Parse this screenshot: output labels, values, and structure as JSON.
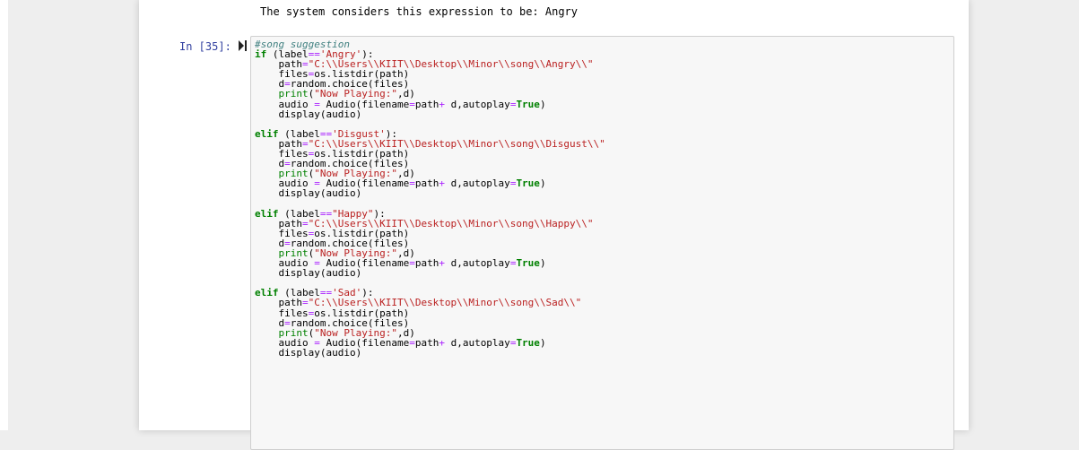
{
  "output": {
    "text": "The system considers this expression to be: Angry"
  },
  "cell": {
    "prompt": "In [35]:",
    "run_icon": "run-step-icon",
    "lines": [
      [
        {
          "t": "#song suggestion",
          "c": "cm"
        }
      ],
      [
        {
          "t": "if",
          "c": "kw"
        },
        {
          "t": " (label"
        },
        {
          "t": "==",
          "c": "op"
        },
        {
          "t": "'Angry'",
          "c": "st"
        },
        {
          "t": "):"
        }
      ],
      [
        {
          "t": "    path"
        },
        {
          "t": "=",
          "c": "op"
        },
        {
          "t": "\"C:\\\\Users\\\\KIIT\\\\Desktop\\\\Minor\\\\song\\\\Angry\\\\\"",
          "c": "st"
        }
      ],
      [
        {
          "t": "    files"
        },
        {
          "t": "=",
          "c": "op"
        },
        {
          "t": "os.listdir(path)"
        }
      ],
      [
        {
          "t": "    d"
        },
        {
          "t": "=",
          "c": "op"
        },
        {
          "t": "random.choice(files)"
        }
      ],
      [
        {
          "t": "    "
        },
        {
          "t": "print",
          "c": "bi"
        },
        {
          "t": "("
        },
        {
          "t": "\"Now Playing:\"",
          "c": "st"
        },
        {
          "t": ",d)"
        }
      ],
      [
        {
          "t": "    audio "
        },
        {
          "t": "=",
          "c": "op"
        },
        {
          "t": " Audio(filename"
        },
        {
          "t": "=",
          "c": "op"
        },
        {
          "t": "path"
        },
        {
          "t": "+",
          "c": "op"
        },
        {
          "t": " d,autoplay"
        },
        {
          "t": "=",
          "c": "op"
        },
        {
          "t": "True",
          "c": "kw"
        },
        {
          "t": ")"
        }
      ],
      [
        {
          "t": "    display(audio)"
        }
      ],
      [
        {
          "t": ""
        }
      ],
      [
        {
          "t": "elif",
          "c": "kw"
        },
        {
          "t": " (label"
        },
        {
          "t": "==",
          "c": "op"
        },
        {
          "t": "'Disgust'",
          "c": "st"
        },
        {
          "t": "):"
        }
      ],
      [
        {
          "t": "    path"
        },
        {
          "t": "=",
          "c": "op"
        },
        {
          "t": "\"C:\\\\Users\\\\KIIT\\\\Desktop\\\\Minor\\\\song\\\\Disgust\\\\\"",
          "c": "st"
        }
      ],
      [
        {
          "t": "    files"
        },
        {
          "t": "=",
          "c": "op"
        },
        {
          "t": "os.listdir(path)"
        }
      ],
      [
        {
          "t": "    d"
        },
        {
          "t": "=",
          "c": "op"
        },
        {
          "t": "random.choice(files)"
        }
      ],
      [
        {
          "t": "    "
        },
        {
          "t": "print",
          "c": "bi"
        },
        {
          "t": "("
        },
        {
          "t": "\"Now Playing:\"",
          "c": "st"
        },
        {
          "t": ",d)"
        }
      ],
      [
        {
          "t": "    audio "
        },
        {
          "t": "=",
          "c": "op"
        },
        {
          "t": " Audio(filename"
        },
        {
          "t": "=",
          "c": "op"
        },
        {
          "t": "path"
        },
        {
          "t": "+",
          "c": "op"
        },
        {
          "t": " d,autoplay"
        },
        {
          "t": "=",
          "c": "op"
        },
        {
          "t": "True",
          "c": "kw"
        },
        {
          "t": ")"
        }
      ],
      [
        {
          "t": "    display(audio)"
        }
      ],
      [
        {
          "t": ""
        }
      ],
      [
        {
          "t": "elif",
          "c": "kw"
        },
        {
          "t": " (label"
        },
        {
          "t": "==",
          "c": "op"
        },
        {
          "t": "\"Happy\"",
          "c": "st"
        },
        {
          "t": "):"
        }
      ],
      [
        {
          "t": "    path"
        },
        {
          "t": "=",
          "c": "op"
        },
        {
          "t": "\"C:\\\\Users\\\\KIIT\\\\Desktop\\\\Minor\\\\song\\\\Happy\\\\\"",
          "c": "st"
        }
      ],
      [
        {
          "t": "    files"
        },
        {
          "t": "=",
          "c": "op"
        },
        {
          "t": "os.listdir(path)"
        }
      ],
      [
        {
          "t": "    d"
        },
        {
          "t": "=",
          "c": "op"
        },
        {
          "t": "random.choice(files)"
        }
      ],
      [
        {
          "t": "    "
        },
        {
          "t": "print",
          "c": "bi"
        },
        {
          "t": "("
        },
        {
          "t": "\"Now Playing:\"",
          "c": "st"
        },
        {
          "t": ",d)"
        }
      ],
      [
        {
          "t": "    audio "
        },
        {
          "t": "=",
          "c": "op"
        },
        {
          "t": " Audio(filename"
        },
        {
          "t": "=",
          "c": "op"
        },
        {
          "t": "path"
        },
        {
          "t": "+",
          "c": "op"
        },
        {
          "t": " d,autoplay"
        },
        {
          "t": "=",
          "c": "op"
        },
        {
          "t": "True",
          "c": "kw"
        },
        {
          "t": ")"
        }
      ],
      [
        {
          "t": "    display(audio)"
        }
      ],
      [
        {
          "t": ""
        }
      ],
      [
        {
          "t": "elif",
          "c": "kw"
        },
        {
          "t": " (label"
        },
        {
          "t": "==",
          "c": "op"
        },
        {
          "t": "'Sad'",
          "c": "st"
        },
        {
          "t": "):"
        }
      ],
      [
        {
          "t": "    path"
        },
        {
          "t": "=",
          "c": "op"
        },
        {
          "t": "\"C:\\\\Users\\\\KIIT\\\\Desktop\\\\Minor\\\\song\\\\Sad\\\\\"",
          "c": "st"
        }
      ],
      [
        {
          "t": "    files"
        },
        {
          "t": "=",
          "c": "op"
        },
        {
          "t": "os.listdir(path)"
        }
      ],
      [
        {
          "t": "    d"
        },
        {
          "t": "=",
          "c": "op"
        },
        {
          "t": "random.choice(files)"
        }
      ],
      [
        {
          "t": "    "
        },
        {
          "t": "print",
          "c": "bi"
        },
        {
          "t": "("
        },
        {
          "t": "\"Now Playing:\"",
          "c": "st"
        },
        {
          "t": ",d)"
        }
      ],
      [
        {
          "t": "    audio "
        },
        {
          "t": "=",
          "c": "op"
        },
        {
          "t": " Audio(filename"
        },
        {
          "t": "=",
          "c": "op"
        },
        {
          "t": "path"
        },
        {
          "t": "+",
          "c": "op"
        },
        {
          "t": " d,autoplay"
        },
        {
          "t": "=",
          "c": "op"
        },
        {
          "t": "True",
          "c": "kw"
        },
        {
          "t": ")"
        }
      ],
      [
        {
          "t": "    display(audio)"
        }
      ]
    ]
  }
}
